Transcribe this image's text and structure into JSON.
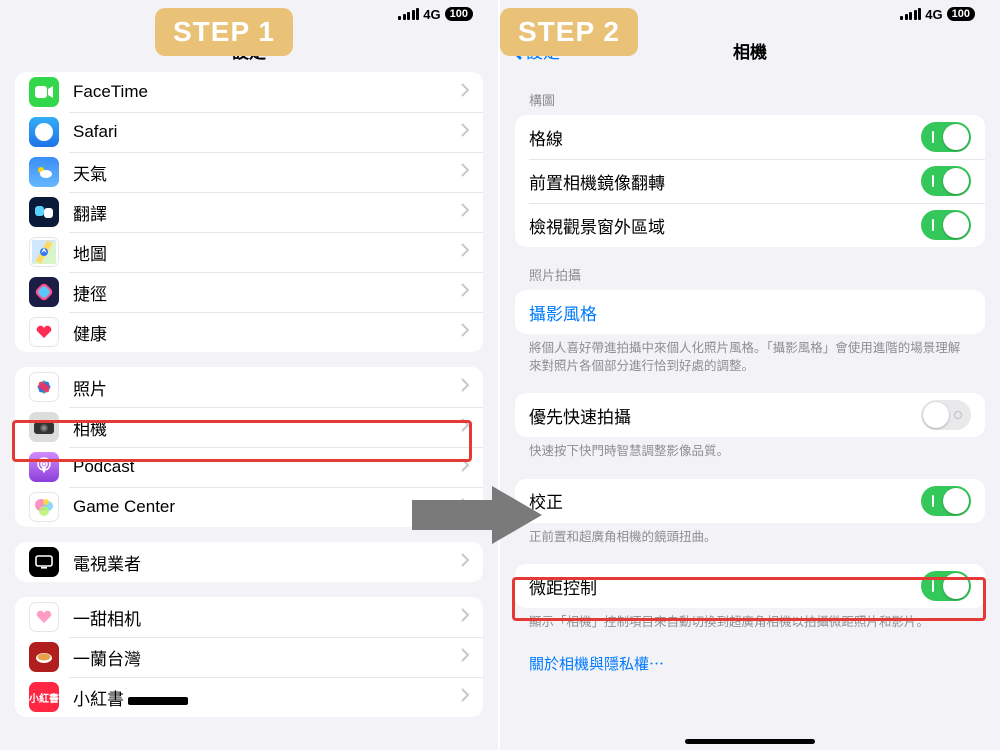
{
  "step_labels": {
    "one": "STEP 1",
    "two": "STEP 2"
  },
  "status": {
    "network": "4G",
    "battery": "100"
  },
  "left": {
    "title": "設定",
    "group1": [
      {
        "name": "facetime",
        "label": "FaceTime",
        "bg": "#32d74b"
      },
      {
        "name": "safari",
        "label": "Safari",
        "bg": "#ffffff"
      },
      {
        "name": "weather",
        "label": "天氣",
        "bg": "#2f7cf6"
      },
      {
        "name": "translate",
        "label": "翻譯",
        "bg": "#101828"
      },
      {
        "name": "maps",
        "label": "地圖",
        "bg": "#ffffff"
      },
      {
        "name": "shortcuts",
        "label": "捷徑",
        "bg": "#19193b"
      },
      {
        "name": "health",
        "label": "健康",
        "bg": "#ffffff"
      }
    ],
    "group2": [
      {
        "name": "photos",
        "label": "照片",
        "bg": "#ffffff"
      },
      {
        "name": "camera",
        "label": "相機",
        "bg": "#dedede"
      },
      {
        "name": "podcast",
        "label": "Podcast",
        "bg": "#9b4de0"
      },
      {
        "name": "gamecenter",
        "label": "Game Center",
        "bg": "#ffffff"
      }
    ],
    "group3": [
      {
        "name": "tvprovider",
        "label": "電視業者",
        "bg": "#000000"
      }
    ],
    "group4": [
      {
        "name": "yitian",
        "label": "一甜相机",
        "bg": "#ffffff"
      },
      {
        "name": "ichiran",
        "label": "一蘭台灣",
        "bg": "#b01e1e"
      },
      {
        "name": "xhs",
        "label": "小紅書",
        "bg": "#ff2741"
      }
    ]
  },
  "right": {
    "back": "設定",
    "title": "相機",
    "sections": {
      "composition": {
        "header": "構圖",
        "rows": [
          {
            "name": "grid",
            "label": "格線",
            "on": true
          },
          {
            "name": "mirror-front",
            "label": "前置相機鏡像翻轉",
            "on": true
          },
          {
            "name": "view-outside",
            "label": "檢視觀景窗外區域",
            "on": true
          }
        ]
      },
      "capture": {
        "header": "照片拍攝",
        "styles_link": "攝影風格",
        "styles_note": "將個人喜好帶進拍攝中來個人化照片風格。「攝影風格」會使用進階的場景理解來對照片各個部分進行恰到好處的調整。"
      },
      "prioritize": {
        "label": "優先快速拍攝",
        "on": false,
        "note": "快速按下快門時智慧調整影像品質。"
      },
      "lens": {
        "label": "校正",
        "on": true,
        "note": "正前置和超廣角相機的鏡頭扭曲。"
      },
      "macro": {
        "label": "微距控制",
        "on": true,
        "note": "顯示「相機」控制項目來自動切換到超廣角相機以拍攝微距照片和影片。"
      },
      "privacy_link": "關於相機與隱私權⋯"
    }
  }
}
